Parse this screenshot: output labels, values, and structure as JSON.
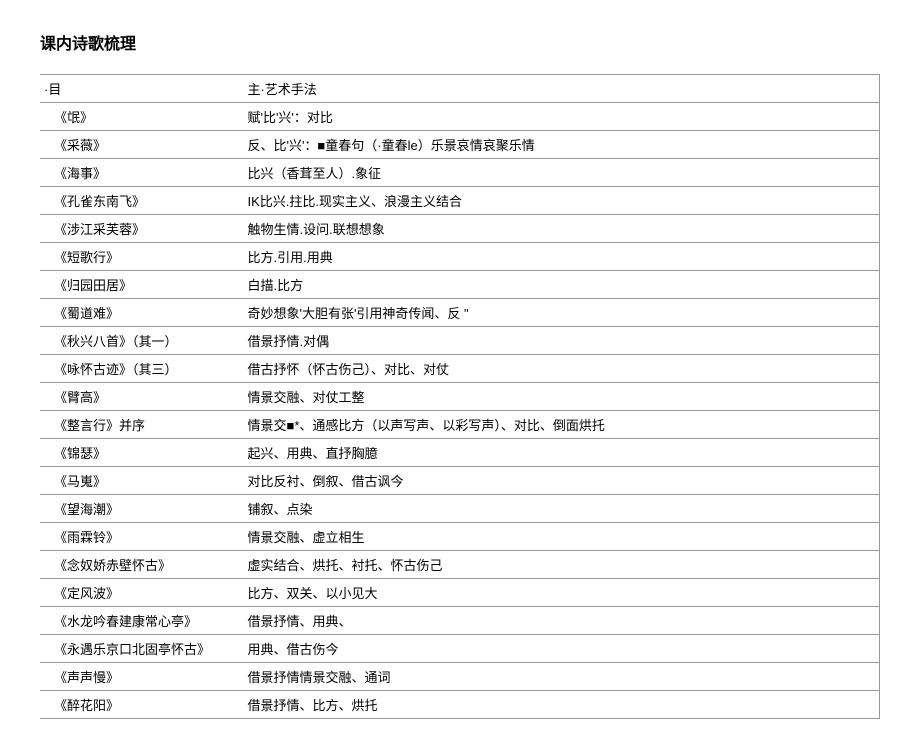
{
  "title": "课内诗歌梳理",
  "headers": {
    "col1": "·目",
    "col2": "主·艺术手法"
  },
  "rows": [
    {
      "name": "《氓》",
      "technique": "赋'比'兴'：对比"
    },
    {
      "name": "《采薇》",
      "technique": "反、比'兴'：■童春句（·童春le）乐景哀情哀聚乐情"
    },
    {
      "name": "《海事》",
      "technique": "比兴（香茸至人）.象征"
    },
    {
      "name": "《孔雀东南飞》",
      "technique": "IK比兴.拄比.现实主义、浪漫主义结合"
    },
    {
      "name": "《涉江采芙蓉》",
      "technique": "触物生情.设问.联想想象"
    },
    {
      "name": "《短歌行》",
      "technique": "比方.引用.用典"
    },
    {
      "name": "《归园田居》",
      "technique": "白描.比方"
    },
    {
      "name": "《蜀道难》",
      "technique": "奇妙想象'大胆有张'引用神奇传闻、反 \""
    },
    {
      "name": "《秋兴八首》（其一）",
      "technique": "借景抒情.对偶"
    },
    {
      "name": "《咏怀古迹》（其三）",
      "technique": "借古抒怀（怀古伤己）、对比、对仗"
    },
    {
      "name": "《臂高》",
      "technique": "情景交融、对仗工整"
    },
    {
      "name": "《整言行》并序",
      "technique": "情景交■*、通感比方（以声写声、以彩写声）、对比、倒面烘托"
    },
    {
      "name": "《锦瑟》",
      "technique": "起兴、用典、直抒胸臆"
    },
    {
      "name": "《马嵬》",
      "technique": "对比反衬、倒叙、借古讽今"
    },
    {
      "name": "《望海潮》",
      "technique": "铺叙、点染"
    },
    {
      "name": "《雨霖铃》",
      "technique": "情景交融、虚立相生"
    },
    {
      "name": "《念奴娇赤壁怀古》",
      "technique": "虚实结合、烘托、衬托、怀古伤己"
    },
    {
      "name": "《定风波》",
      "technique": "比方、双关、以小见大"
    },
    {
      "name": "《水龙吟春建康常心亭》",
      "technique": "借景抒情、用典、"
    },
    {
      "name": "《永遇乐京口北固亭怀古》",
      "technique": "用典、借古伤今"
    },
    {
      "name": "《声声慢》",
      "technique": "借景抒情情景交融、通词"
    },
    {
      "name": "《醉花阳》",
      "technique": "借景抒情、比方、烘托"
    }
  ]
}
